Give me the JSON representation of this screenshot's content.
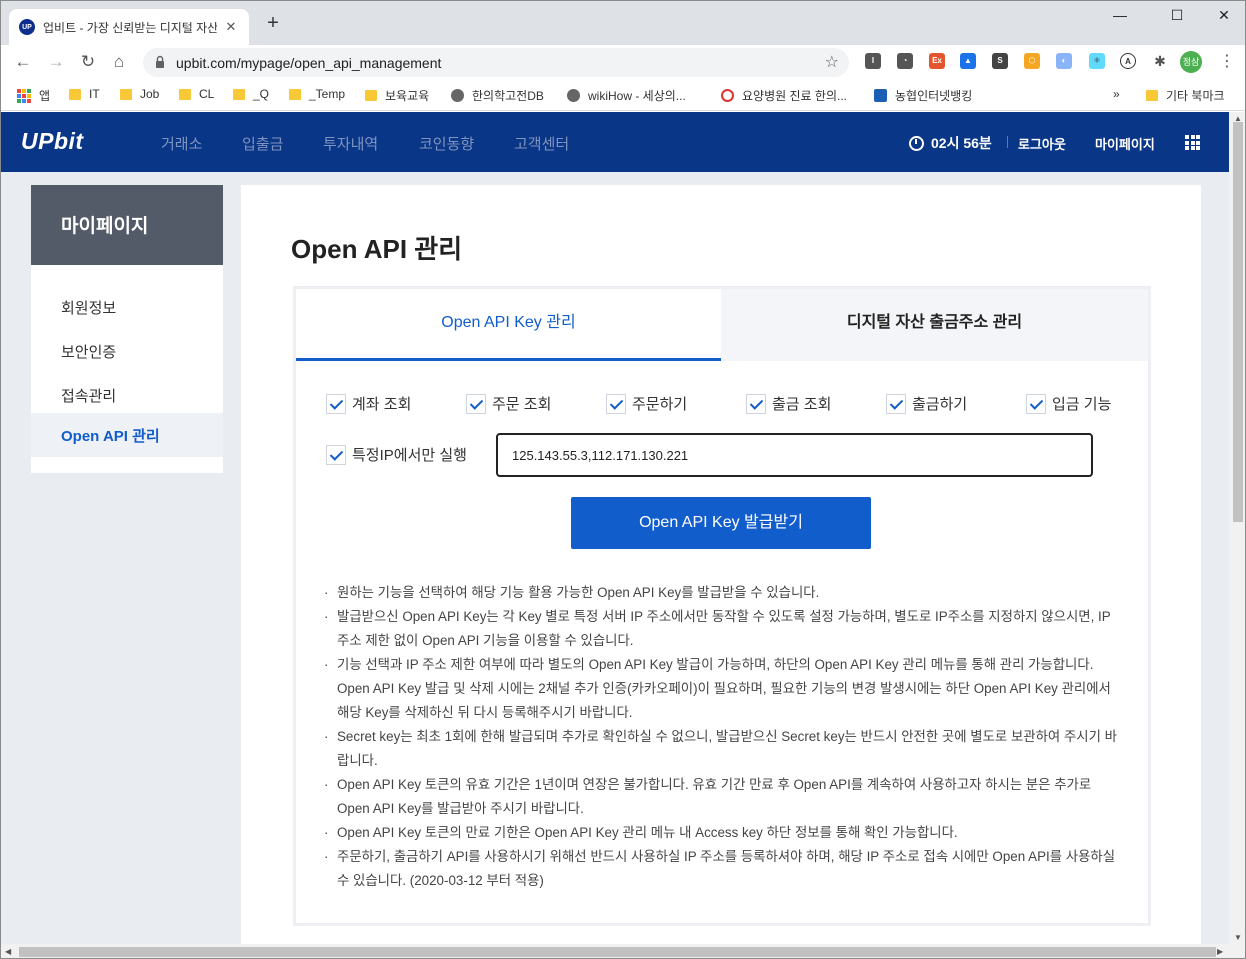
{
  "browser": {
    "tab_title": "업비트 - 가장 신뢰받는 디지털 자산 거래소",
    "tab_favicon": "UP",
    "url": "upbit.com/mypage/open_api_management",
    "profile": "정삼",
    "bookmarks": [
      "앱",
      "IT",
      "Job",
      "CL",
      "_Q",
      "_Temp",
      "보육교육",
      "한의학고전DB",
      "wikiHow - 세상의...",
      "요양병원 진료 한의...",
      "농협인터넷뱅킹",
      "»",
      "기타 북마크"
    ],
    "extensions": [
      "I",
      "Ex",
      "S"
    ]
  },
  "header": {
    "logo": "UPbit",
    "nav": [
      "거래소",
      "입출금",
      "투자내역",
      "코인동향",
      "고객센터"
    ],
    "timer": "02시 56분",
    "logout": "로그아웃",
    "mypage": "마이페이지"
  },
  "sidebar": {
    "title": "마이페이지",
    "items": [
      "회원정보",
      "보안인증",
      "접속관리",
      "Open API 관리"
    ],
    "active_index": 3
  },
  "main": {
    "title": "Open API 관리",
    "tabs": [
      "Open API Key 관리",
      "디지털 자산 출금주소 관리"
    ],
    "permissions": [
      "계좌 조회",
      "주문 조회",
      "주문하기",
      "출금 조회",
      "출금하기",
      "입금 기능"
    ],
    "ip_checkbox_label": "특정IP에서만 실행",
    "ip_value": "125.143.55.3,112.171.130.221",
    "issue_button": "Open API Key 발급받기",
    "notes": [
      "원하는 기능을 선택하여 해당 기능 활용 가능한 Open API Key를 발급받을 수 있습니다.",
      "발급받으신 Open API Key는 각 Key 별로 특정 서버 IP 주소에서만 동작할 수 있도록 설정 가능하며, 별도로 IP주소를 지정하지 않으시면, IP 주소 제한 없이 Open API 기능을 이용할 수 있습니다.",
      "기능 선택과 IP 주소 제한 여부에 따라 별도의 Open API Key 발급이 가능하며, 하단의 Open API Key 관리 메뉴를 통해 관리 가능합니다. Open API Key 발급 및 삭제 시에는 2채널 추가 인증(카카오페이)이 필요하며, 필요한 기능의 변경 발생시에는 하단 Open API Key 관리에서 해당 Key를 삭제하신 뒤 다시 등록해주시기 바랍니다.",
      "Secret key는 최초 1회에 한해 발급되며 추가로 확인하실 수 없으니, 발급받으신 Secret key는 반드시 안전한 곳에 별도로 보관하여 주시기 바랍니다.",
      "Open API Key 토큰의 유효 기간은 1년이며 연장은 불가합니다. 유효 기간 만료 후 Open API를 계속하여 사용하고자 하시는 분은 추가로 Open API Key를 발급받아 주시기 바랍니다.",
      "Open API Key 토큰의 만료 기한은 Open API Key 관리 메뉴 내 Access key 하단 정보를 통해 확인 가능합니다.",
      "주문하기, 출금하기 API를 사용하시기 위해선 반드시 사용하실 IP 주소를 등록하셔야 하며, 해당 IP 주소로 접속 시에만 Open API를 사용하실 수 있습니다. (2020-03-12 부터 적용)"
    ]
  },
  "colors": {
    "header_bg": "#093687",
    "accent": "#115dcb",
    "sidebar_title_bg": "#535a68",
    "page_bg": "#e9ecf1"
  },
  "icons": [
    "close-icon",
    "plus-icon",
    "back-arrow-icon",
    "forward-arrow-icon",
    "reload-icon",
    "home-icon",
    "lock-icon",
    "star-icon",
    "puzzle-icon",
    "kebab-icon",
    "clock-icon",
    "grid-menu-icon",
    "checkmark-icon",
    "folder-icon",
    "globe-icon"
  ]
}
